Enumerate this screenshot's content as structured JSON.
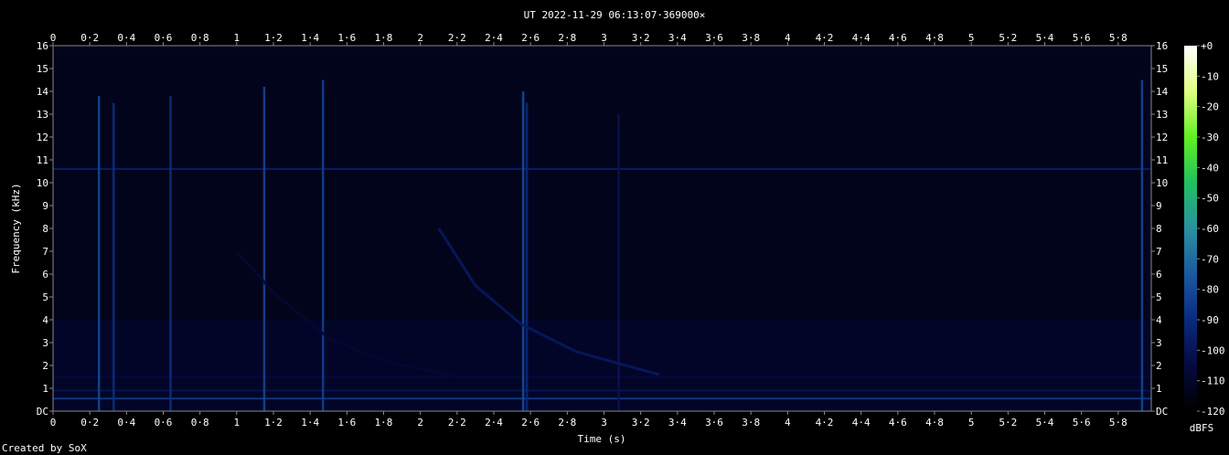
{
  "chart_data": {
    "type": "heatmap",
    "title": "UT 2022-11-29 06:13:07·369000×",
    "xlabel": "Time (s)",
    "ylabel": "Frequency (kHz)",
    "xlim": [
      0,
      5.98
    ],
    "ylim": [
      0,
      16
    ],
    "x_ticks": [
      "0",
      "0·2",
      "0·4",
      "0·6",
      "0·8",
      "1",
      "1·2",
      "1·4",
      "1·6",
      "1·8",
      "2",
      "2·2",
      "2·4",
      "2·6",
      "2·8",
      "3",
      "3·2",
      "3·4",
      "3·6",
      "3·8",
      "4",
      "4·2",
      "4·4",
      "4·6",
      "4·8",
      "5",
      "5·2",
      "5·4",
      "5·6",
      "5·8"
    ],
    "y_ticks": [
      "DC",
      "1",
      "2",
      "3",
      "4",
      "5",
      "6",
      "7",
      "8",
      "9",
      "10",
      "11",
      "12",
      "13",
      "14",
      "15",
      "16"
    ],
    "colorbar": {
      "label": "dBFS",
      "range": [
        -120,
        0
      ],
      "ticks": [
        "+0",
        "-10",
        "-20",
        "-30",
        "-40",
        "-50",
        "-60",
        "-70",
        "-80",
        "-90",
        "-100",
        "-110",
        "-120"
      ],
      "colors": [
        "#000000",
        "#050a40",
        "#0a2a80",
        "#1a5aa0",
        "#2a90a0",
        "#20c060",
        "#60f020",
        "#e0ff80",
        "#ffffff"
      ]
    },
    "background_color": "#02041c",
    "horizontal_lines": [
      {
        "freq_khz": 10.6,
        "level_db": -95
      },
      {
        "freq_khz": 0.55,
        "level_db": -85
      },
      {
        "freq_khz": 0.9,
        "level_db": -100
      },
      {
        "freq_khz": 1.5,
        "level_db": -105
      }
    ],
    "impulses": [
      {
        "t": 0.25,
        "fmax": 13.8,
        "level_db": -80
      },
      {
        "t": 0.33,
        "fmax": 13.5,
        "level_db": -88
      },
      {
        "t": 0.64,
        "fmax": 13.8,
        "level_db": -88
      },
      {
        "t": 1.15,
        "fmax": 14.2,
        "level_db": -80
      },
      {
        "t": 1.47,
        "fmax": 14.5,
        "level_db": -82
      },
      {
        "t": 2.56,
        "fmax": 14.0,
        "level_db": -78
      },
      {
        "t": 2.58,
        "fmax": 13.5,
        "level_db": -90
      },
      {
        "t": 3.08,
        "fmax": 13.0,
        "level_db": -100
      },
      {
        "t": 5.93,
        "fmax": 14.5,
        "level_db": -80
      }
    ],
    "whistlers": [
      {
        "points": [
          [
            2.1,
            8.0
          ],
          [
            2.3,
            5.5
          ],
          [
            2.55,
            3.8
          ],
          [
            2.85,
            2.6
          ],
          [
            3.3,
            1.6
          ]
        ],
        "level_db": -98
      },
      {
        "points": [
          [
            1.0,
            7.0
          ],
          [
            1.2,
            5.2
          ],
          [
            1.5,
            3.2
          ],
          [
            1.8,
            2.2
          ],
          [
            2.2,
            1.5
          ]
        ],
        "level_db": -108
      }
    ]
  },
  "footer": {
    "credit": "Created by SoX"
  }
}
